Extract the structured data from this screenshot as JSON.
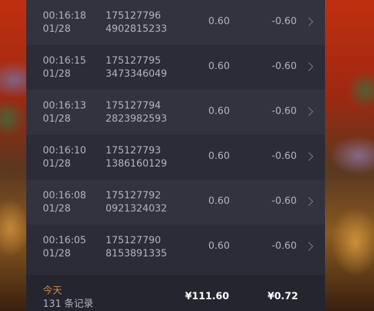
{
  "records": [
    {
      "time": "00:16:18",
      "date": "01/28",
      "order_line1": "175127796",
      "order_line2": "4902815233",
      "amount": "0.60",
      "net": "-0.60"
    },
    {
      "time": "00:16:15",
      "date": "01/28",
      "order_line1": "175127795",
      "order_line2": "3473346049",
      "amount": "0.60",
      "net": "-0.60"
    },
    {
      "time": "00:16:13",
      "date": "01/28",
      "order_line1": "175127794",
      "order_line2": "2823982593",
      "amount": "0.60",
      "net": "-0.60"
    },
    {
      "time": "00:16:10",
      "date": "01/28",
      "order_line1": "175127793",
      "order_line2": "1386160129",
      "amount": "0.60",
      "net": "-0.60"
    },
    {
      "time": "00:16:08",
      "date": "01/28",
      "order_line1": "175127792",
      "order_line2": "0921324032",
      "amount": "0.60",
      "net": "-0.60"
    },
    {
      "time": "00:16:05",
      "date": "01/28",
      "order_line1": "175127790",
      "order_line2": "8153891335",
      "amount": "0.60",
      "net": "-0.60"
    }
  ],
  "summary": {
    "period_label": "今天",
    "record_count": "131 条记录",
    "total_amount": "¥111.60",
    "total_net": "¥0.72"
  },
  "colors": {
    "panel": "#2b2c37",
    "row_alt": "#32333f",
    "accent": "#c8874a",
    "text": "#b4b6c2"
  }
}
